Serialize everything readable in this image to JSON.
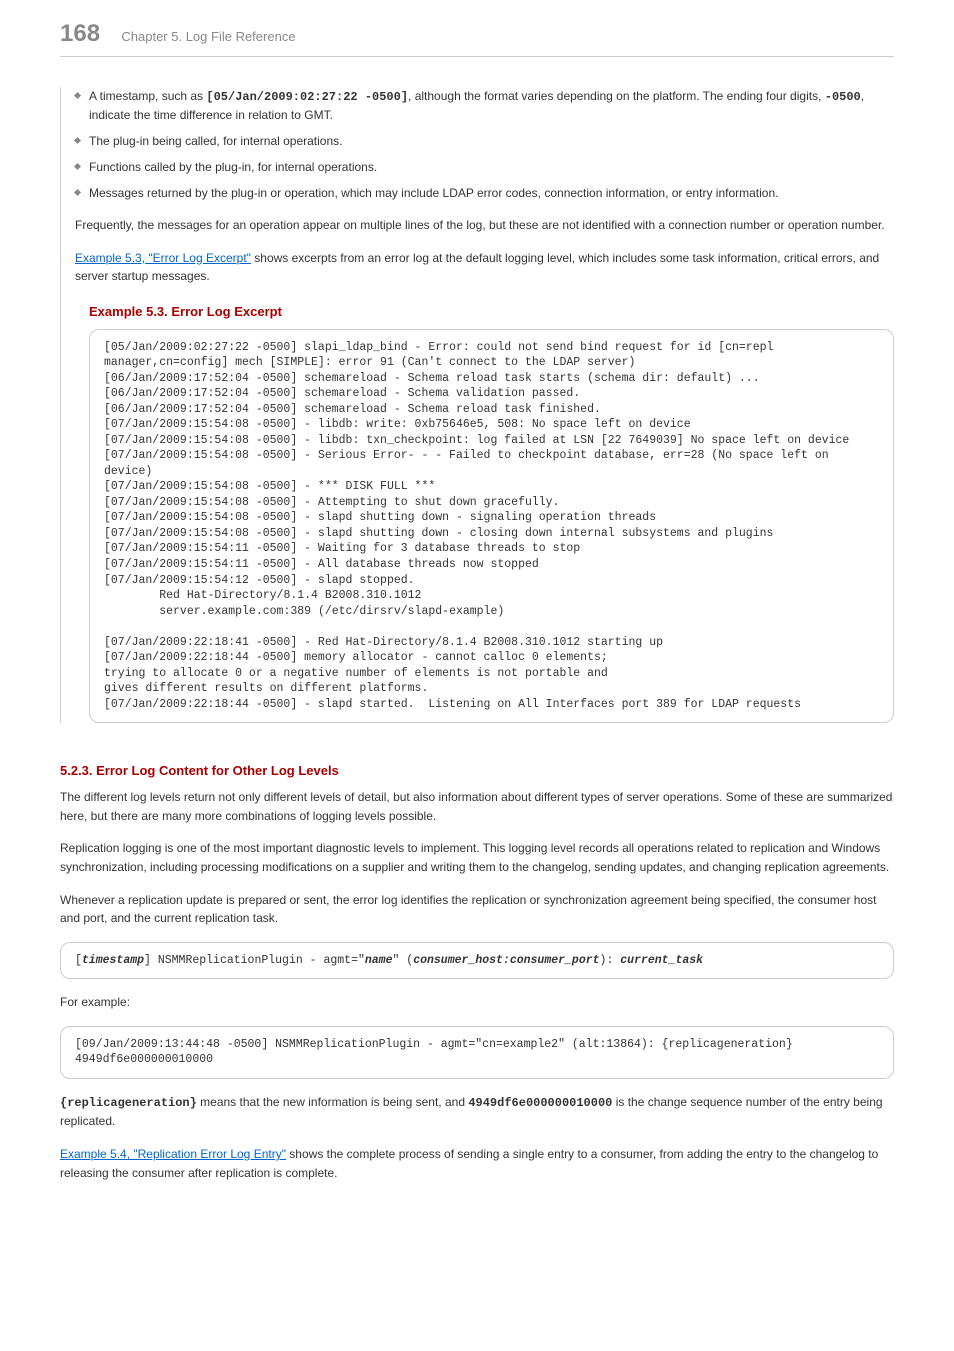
{
  "header": {
    "pageNumber": "168",
    "chapterTitle": "Chapter 5. Log File Reference"
  },
  "bullets": {
    "b1_pre": "A timestamp, such as ",
    "b1_code1": "[05/Jan/2009:02:27:22 -0500]",
    "b1_mid": ", although the format varies depending on the platform. The ending four digits, ",
    "b1_code2": "-0500",
    "b1_post": ", indicate the time difference in relation to GMT.",
    "b2": "The plug-in being called, for internal operations.",
    "b3": "Functions called by the plug-in, for internal operations.",
    "b4": "Messages returned by the plug-in or operation, which may include LDAP error codes, connection information, or entry information."
  },
  "para_freq": "Frequently, the messages for an operation appear on multiple lines of the log, but these are not identified with a connection number or operation number.",
  "link_ex53": "Example 5.3, \"Error Log Excerpt\"",
  "para_link_tail": " shows excerpts from an error log at the default logging level, which includes some task information, critical errors, and server startup messages.",
  "example53_title": "Example 5.3. Error Log Excerpt",
  "code1": "[05/Jan/2009:02:27:22 -0500] slapi_ldap_bind - Error: could not send bind request for id [cn=repl manager,cn=config] mech [SIMPLE]: error 91 (Can't connect to the LDAP server)\n[06/Jan/2009:17:52:04 -0500] schemareload - Schema reload task starts (schema dir: default) ...\n[06/Jan/2009:17:52:04 -0500] schemareload - Schema validation passed.\n[06/Jan/2009:17:52:04 -0500] schemareload - Schema reload task finished.\n[07/Jan/2009:15:54:08 -0500] - libdb: write: 0xb75646e5, 508: No space left on device\n[07/Jan/2009:15:54:08 -0500] - libdb: txn_checkpoint: log failed at LSN [22 7649039] No space left on device\n[07/Jan/2009:15:54:08 -0500] - Serious Error- - - Failed to checkpoint database, err=28 (No space left on device)\n[07/Jan/2009:15:54:08 -0500] - *** DISK FULL ***\n[07/Jan/2009:15:54:08 -0500] - Attempting to shut down gracefully.\n[07/Jan/2009:15:54:08 -0500] - slapd shutting down - signaling operation threads\n[07/Jan/2009:15:54:08 -0500] - slapd shutting down - closing down internal subsystems and plugins\n[07/Jan/2009:15:54:11 -0500] - Waiting for 3 database threads to stop\n[07/Jan/2009:15:54:11 -0500] - All database threads now stopped\n[07/Jan/2009:15:54:12 -0500] - slapd stopped.\n        Red Hat-Directory/8.1.4 B2008.310.1012\n        server.example.com:389 (/etc/dirsrv/slapd-example)\n\n[07/Jan/2009:22:18:41 -0500] - Red Hat-Directory/8.1.4 B2008.310.1012 starting up\n[07/Jan/2009:22:18:44 -0500] memory allocator - cannot calloc 0 elements;\ntrying to allocate 0 or a negative number of elements is not portable and\ngives different results on different platforms.\n[07/Jan/2009:22:18:44 -0500] - slapd started.  Listening on All Interfaces port 389 for LDAP requests",
  "section523_title": "5.2.3. Error Log Content for Other Log Levels",
  "para523_1": "The different log levels return not only different levels of detail, but also information about different types of server operations. Some of these are summarized here, but there are many more combinations of logging levels possible.",
  "para523_2": "Replication logging is one of the most important diagnostic levels to implement. This logging level records all operations related to replication and Windows synchronization, including processing modifications on a supplier and writing them to the changelog, sending updates, and changing replication agreements.",
  "para523_3": "Whenever a replication update is prepared or sent, the error log identifies the replication or synchronization agreement being specified, the consumer host and port, and the current replication task.",
  "code2_open": "[",
  "code2_ts": "timestamp",
  "code2_mid1": "] NSMMReplicationPlugin - agmt=\"",
  "code2_name": "name",
  "code2_mid2": "\" (",
  "code2_hp": "consumer_host:consumer_port",
  "code2_mid3": "): ",
  "code2_task": "current_task",
  "para_forex": "For example:",
  "code3": "[09/Jan/2009:13:44:48 -0500] NSMMReplicationPlugin - agmt=\"cn=example2\" (alt:13864): {replicageneration} 4949df6e000000010000",
  "para_repl_code1": "{replicageneration}",
  "para_repl_mid1": " means that the new information is being sent, and ",
  "para_repl_code2": "4949df6e000000010000",
  "para_repl_mid2": " is the change sequence number of the entry being replicated.",
  "link_ex54": "Example 5.4, \"Replication Error Log Entry\"",
  "para_link54_tail": " shows the complete process of sending a single entry to a consumer, from adding the entry to the changelog to releasing the consumer after replication is complete."
}
